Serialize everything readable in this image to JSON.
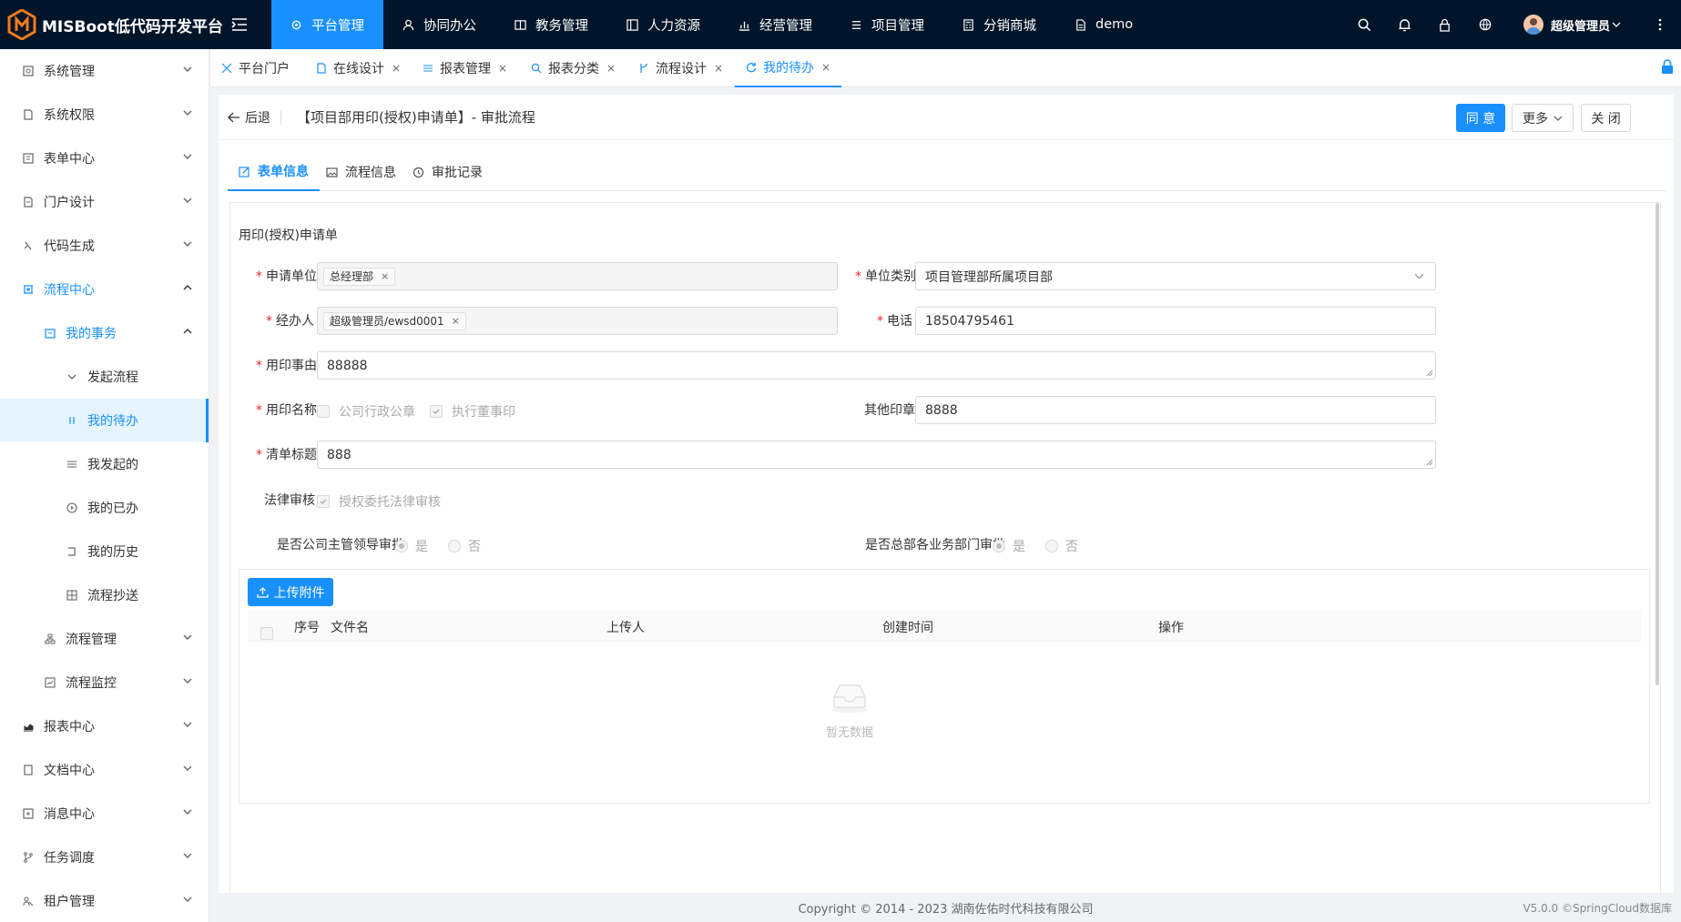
{
  "app": {
    "title": "MISBoot低代码开发平台"
  },
  "colors": {
    "accent": "#1890ff",
    "topbar": "#001529",
    "danger": "#f5222d"
  },
  "topnav": {
    "items": [
      {
        "label": "平台管理",
        "icon": "gear-icon",
        "active": true
      },
      {
        "label": "协同办公",
        "icon": "user-icon"
      },
      {
        "label": "教务管理",
        "icon": "book-icon"
      },
      {
        "label": "人力资源",
        "icon": "layout-icon"
      },
      {
        "label": "经营管理",
        "icon": "bar-chart-icon"
      },
      {
        "label": "项目管理",
        "icon": "list-icon"
      },
      {
        "label": "分销商城",
        "icon": "calculator-icon"
      },
      {
        "label": "demo",
        "icon": "file-icon"
      }
    ],
    "user": "超级管理员"
  },
  "sidebar": {
    "items": [
      {
        "label": "系统管理",
        "icon": "settings-icon"
      },
      {
        "label": "系统权限",
        "icon": "lock-file-icon"
      },
      {
        "label": "表单中心",
        "icon": "form-icon"
      },
      {
        "label": "门户设计",
        "icon": "portal-icon"
      },
      {
        "label": "代码生成",
        "icon": "code-icon"
      },
      {
        "label": "流程中心",
        "icon": "flow-icon"
      },
      {
        "label": "我的事务",
        "icon": "calendar-icon"
      },
      {
        "label": "发起流程",
        "icon": "chevron-icon"
      },
      {
        "label": "我的待办",
        "icon": "pause-icon"
      },
      {
        "label": "我发起的",
        "icon": "list-icon"
      },
      {
        "label": "我的已办",
        "icon": "play-icon"
      },
      {
        "label": "我的历史",
        "icon": "return-icon"
      },
      {
        "label": "流程抄送",
        "icon": "grid-icon"
      },
      {
        "label": "流程管理",
        "icon": "org-icon"
      },
      {
        "label": "流程监控",
        "icon": "monitor-icon"
      },
      {
        "label": "报表中心",
        "icon": "chart-icon"
      },
      {
        "label": "文档中心",
        "icon": "doc-icon"
      },
      {
        "label": "消息中心",
        "icon": "message-icon"
      },
      {
        "label": "任务调度",
        "icon": "branch-icon"
      },
      {
        "label": "租户管理",
        "icon": "tenant-icon"
      }
    ]
  },
  "tabs": {
    "items": [
      {
        "label": "平台门户"
      },
      {
        "label": "在线设计"
      },
      {
        "label": "报表管理"
      },
      {
        "label": "报表分类"
      },
      {
        "label": "流程设计"
      },
      {
        "label": "我的待办"
      }
    ],
    "close": "×"
  },
  "page": {
    "back": "后退",
    "title": "【项目部用印(授权)申请单】- 审批流程",
    "agree": "同 意",
    "more": "更多",
    "close": "关 闭"
  },
  "form_tabs": [
    "表单信息",
    "流程信息",
    "审批记录"
  ],
  "form": {
    "title": "用印(授权)申请单",
    "required_mark": "*",
    "apply_unit": {
      "label": "申请单位",
      "tag": "总经理部"
    },
    "unit_type": {
      "label": "单位类别",
      "value": "项目管理部所属项目部"
    },
    "handler": {
      "label": "经办人",
      "tag": "超级管理员/ewsd0001"
    },
    "phone": {
      "label": "电话",
      "value": "18504795461"
    },
    "reason": {
      "label": "用印事由",
      "value": "88888"
    },
    "seal_name": {
      "label": "用印名称",
      "options": [
        "公司行政公章",
        "执行董事印"
      ],
      "checked": [
        false,
        true
      ]
    },
    "other_seal": {
      "label": "其他印章",
      "value": "8888"
    },
    "list_title": {
      "label": "清单标题",
      "value": "888"
    },
    "legal": {
      "label": "法律审核",
      "option": "授权委托法律审核",
      "checked": true
    },
    "leader_approve": {
      "label": "是否公司主管领导审批",
      "options": [
        "是",
        "否"
      ],
      "selected": "是"
    },
    "dept_approve": {
      "label": "是否总部各业务部门审批",
      "options": [
        "是",
        "否"
      ],
      "selected": "是"
    }
  },
  "attachments": {
    "upload": "上传附件",
    "columns": [
      "序号",
      "文件名",
      "上传人",
      "创建时间",
      "操作"
    ],
    "empty": "暂无数据"
  },
  "footer": {
    "copyright": "Copyright © 2014 - 2023 湖南佐佑时代科技有限公司",
    "version": "V5.0.0 ©SpringCloud数据库"
  }
}
